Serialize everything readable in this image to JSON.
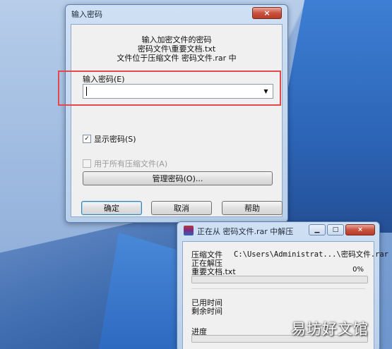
{
  "dialog": {
    "title": "输入密码",
    "close_label": "×",
    "message_line1": "输入加密文件的密码",
    "message_line2": "密码文件\\重要文档.txt",
    "message_line3": "文件位于压缩文件 密码文件.rar 中",
    "password_label": "输入密码(E)",
    "password_value": "",
    "combo_arrow": "▼",
    "show_password": {
      "label": "显示密码(S)",
      "checked": true,
      "mark": "✓"
    },
    "use_for_all": {
      "label": "用于所有压缩文件(A)",
      "checked": false,
      "enabled": false
    },
    "manage_button": "管理密码(O)...",
    "ok_button": "确定",
    "cancel_button": "取消",
    "help_button": "帮助"
  },
  "progress_window": {
    "title": "正在从 密码文件.rar 中解压",
    "min_label": "▁",
    "max_label": "□",
    "close_label": "×",
    "archive_label": "压缩文件",
    "archive_path": "C:\\Users\\Administrat...\\密码文件.rar",
    "status": "正在解压",
    "current_file": "重要文档.txt",
    "file_percent": "0%",
    "file_progress": 0,
    "elapsed_label": "已用时间",
    "remaining_label": "剩余时间",
    "progress_label": "进度",
    "total_progress": 0
  },
  "watermark": "易坊好文馆",
  "colors": {
    "highlight_box": "#e5484b",
    "close_button": "#c9523e",
    "window_frame": "#b8cfea"
  }
}
